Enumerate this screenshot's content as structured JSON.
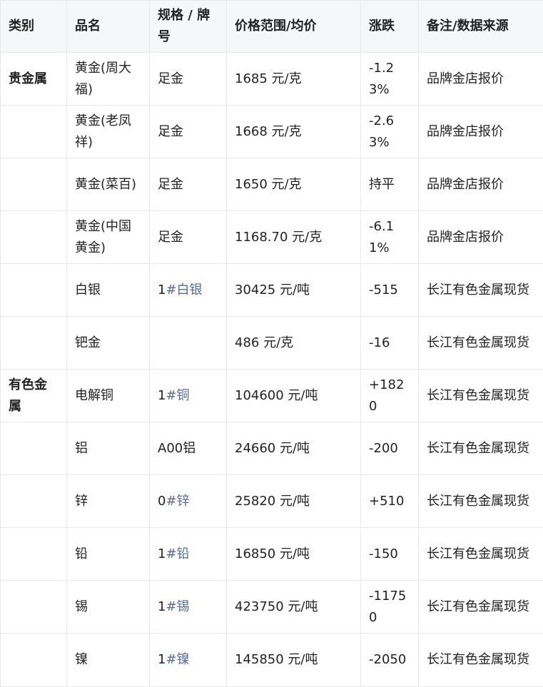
{
  "table": {
    "headers": [
      "类别",
      "品名",
      "规格 / 牌号",
      "价格范围/均价",
      "涨跌",
      "备注/数据来源"
    ],
    "rows": [
      {
        "category": "贵金属",
        "name": "黄金(周大福)",
        "spec_prefix": "足金",
        "spec_tag": "",
        "price": "1685 元/克",
        "change": "-1.23%",
        "source": "品牌金店报价"
      },
      {
        "category": "",
        "name": "黄金(老凤祥)",
        "spec_prefix": "足金",
        "spec_tag": "",
        "price": "1668 元/克",
        "change": "-2.63%",
        "source": "品牌金店报价"
      },
      {
        "category": "",
        "name": "黄金(菜百)",
        "spec_prefix": "足金",
        "spec_tag": "",
        "price": "1650 元/克",
        "change": "持平",
        "source": "品牌金店报价"
      },
      {
        "category": "",
        "name": "黄金(中国黄金)",
        "spec_prefix": "足金",
        "spec_tag": "",
        "price": "1168.70 元/克",
        "change": "-6.11%",
        "source": "品牌金店报价"
      },
      {
        "category": "",
        "name": "白银",
        "spec_prefix": "1",
        "spec_tag": "#白银",
        "price": "30425 元/吨",
        "change": "-515",
        "source": "长江有色金属现货"
      },
      {
        "category": "",
        "name": "钯金",
        "spec_prefix": "",
        "spec_tag": "",
        "price": "486 元/克",
        "change": "-16",
        "source": "长江有色金属现货"
      },
      {
        "category": "有色金属",
        "name": "电解铜",
        "spec_prefix": "1",
        "spec_tag": "#铜",
        "price": "104600 元/吨",
        "change": "+1820",
        "source": "长江有色金属现货"
      },
      {
        "category": "",
        "name": "铝",
        "spec_prefix": "A00铝",
        "spec_tag": "",
        "price": "24660 元/吨",
        "change": "-200",
        "source": "长江有色金属现货"
      },
      {
        "category": "",
        "name": "锌",
        "spec_prefix": "0",
        "spec_tag": "#锌",
        "price": "25820 元/吨",
        "change": "+510",
        "source": "长江有色金属现货"
      },
      {
        "category": "",
        "name": "铅",
        "spec_prefix": "1",
        "spec_tag": "#铅",
        "price": "16850 元/吨",
        "change": "-150",
        "source": "长江有色金属现货"
      },
      {
        "category": "",
        "name": "锡",
        "spec_prefix": "1",
        "spec_tag": "#锡",
        "price": "423750 元/吨",
        "change": "-11750",
        "source": "长江有色金属现货"
      },
      {
        "category": "",
        "name": "镍",
        "spec_prefix": "1",
        "spec_tag": "#镍",
        "price": "145850 元/吨",
        "change": "-2050",
        "source": "长江有色金属现货"
      }
    ]
  }
}
